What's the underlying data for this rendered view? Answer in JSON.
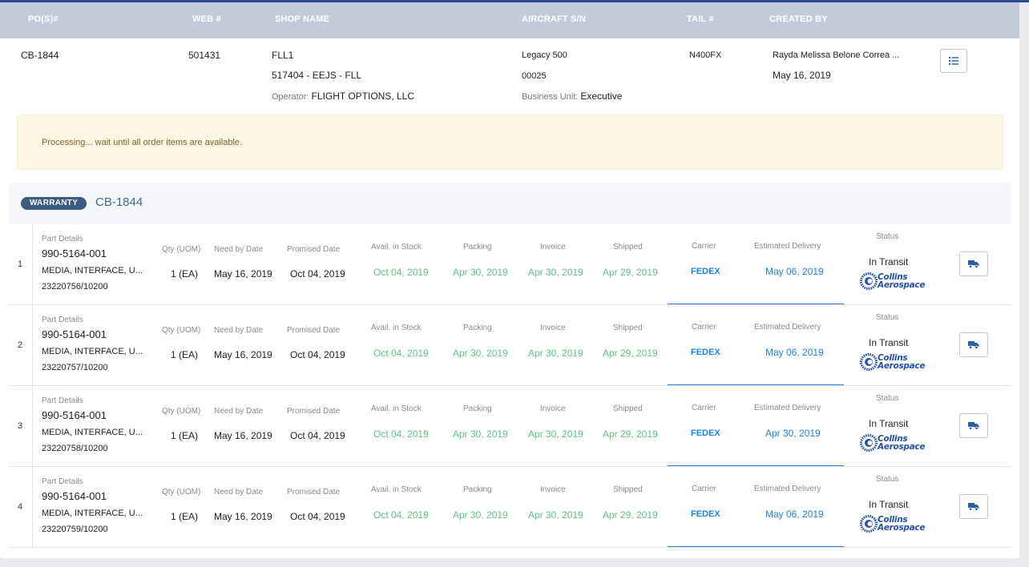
{
  "header": {
    "columns": [
      "PO(S)#",
      "WEB #",
      "SHOP NAME",
      "AIRCRAFT S/N",
      "TAIL #",
      "CREATED BY"
    ]
  },
  "order": {
    "po": "CB-1844",
    "web": "501431",
    "shop_code": "FLL1",
    "shop_detail": "517404 - EEJS - FLL",
    "operator_label": "Operator:",
    "operator": "FLIGHT OPTIONS, LLC",
    "aircraft": "Legacy 500",
    "aircraft_sn": "00025",
    "business_unit_label": "Business Unit:",
    "business_unit": "Executive",
    "tail": "N400FX",
    "created_by": "Rayda Melissa Belone Correa ...",
    "created_date": "May 16, 2019"
  },
  "alert": {
    "message": "Processing... wait until all order items are available."
  },
  "group": {
    "badge": "WARRANTY",
    "title": "CB-1844"
  },
  "labels": {
    "part_details": "Part Details",
    "qty": "Qty (UOM)",
    "need_by": "Need by Date",
    "promised": "Promised Date",
    "avail": "Avail. in Stock",
    "packing": "Packing",
    "invoice": "Invoice",
    "shipped": "Shipped",
    "carrier": "Carrier",
    "est_delivery": "Estimated Delivery",
    "status": "Status"
  },
  "logo": {
    "line1": "Collins",
    "line2": "Aerospace"
  },
  "items": [
    {
      "index": "1",
      "part_no": "990-5164-001",
      "desc": "MEDIA, INTERFACE, U...",
      "ref": "23220756/10200",
      "qty": "1 (EA)",
      "need_by": "May 16, 2019",
      "promised": "Oct 04, 2019",
      "avail": "Oct 04, 2019",
      "packing": "Apr 30, 2019",
      "invoice": "Apr 30, 2019",
      "shipped": "Apr 29, 2019",
      "carrier": "FEDEX",
      "est_delivery": "May 06, 2019",
      "status": "In Transit"
    },
    {
      "index": "2",
      "part_no": "990-5164-001",
      "desc": "MEDIA, INTERFACE, U...",
      "ref": "23220757/10200",
      "qty": "1 (EA)",
      "need_by": "May 16, 2019",
      "promised": "Oct 04, 2019",
      "avail": "Oct 04, 2019",
      "packing": "Apr 30, 2019",
      "invoice": "Apr 30, 2019",
      "shipped": "Apr 29, 2019",
      "carrier": "FEDEX",
      "est_delivery": "May 06, 2019",
      "status": "In Transit"
    },
    {
      "index": "3",
      "part_no": "990-5164-001",
      "desc": "MEDIA, INTERFACE, U...",
      "ref": "23220758/10200",
      "qty": "1 (EA)",
      "need_by": "May 16, 2019",
      "promised": "Oct 04, 2019",
      "avail": "Oct 04, 2019",
      "packing": "Apr 30, 2019",
      "invoice": "Apr 30, 2019",
      "shipped": "Apr 29, 2019",
      "carrier": "FEDEX",
      "est_delivery": "Apr 30, 2019",
      "status": "In Transit"
    },
    {
      "index": "4",
      "part_no": "990-5164-001",
      "desc": "MEDIA, INTERFACE, U...",
      "ref": "23220759/10200",
      "qty": "1 (EA)",
      "need_by": "May 16, 2019",
      "promised": "Oct 04, 2019",
      "avail": "Oct 04, 2019",
      "packing": "Apr 30, 2019",
      "invoice": "Apr 30, 2019",
      "shipped": "Apr 29, 2019",
      "carrier": "FEDEX",
      "est_delivery": "May 06, 2019",
      "status": "In Transit"
    }
  ],
  "icons": {
    "list": "list-icon",
    "truck": "truck-icon",
    "logo": "collins-logo-icon"
  },
  "colors": {
    "header_bg": "#c3cbd8",
    "accent_blue": "#1c82e2",
    "stage_green": "#5cc383",
    "alert_bg": "#fcf6e2",
    "badge_bg": "#3c5b7e"
  }
}
